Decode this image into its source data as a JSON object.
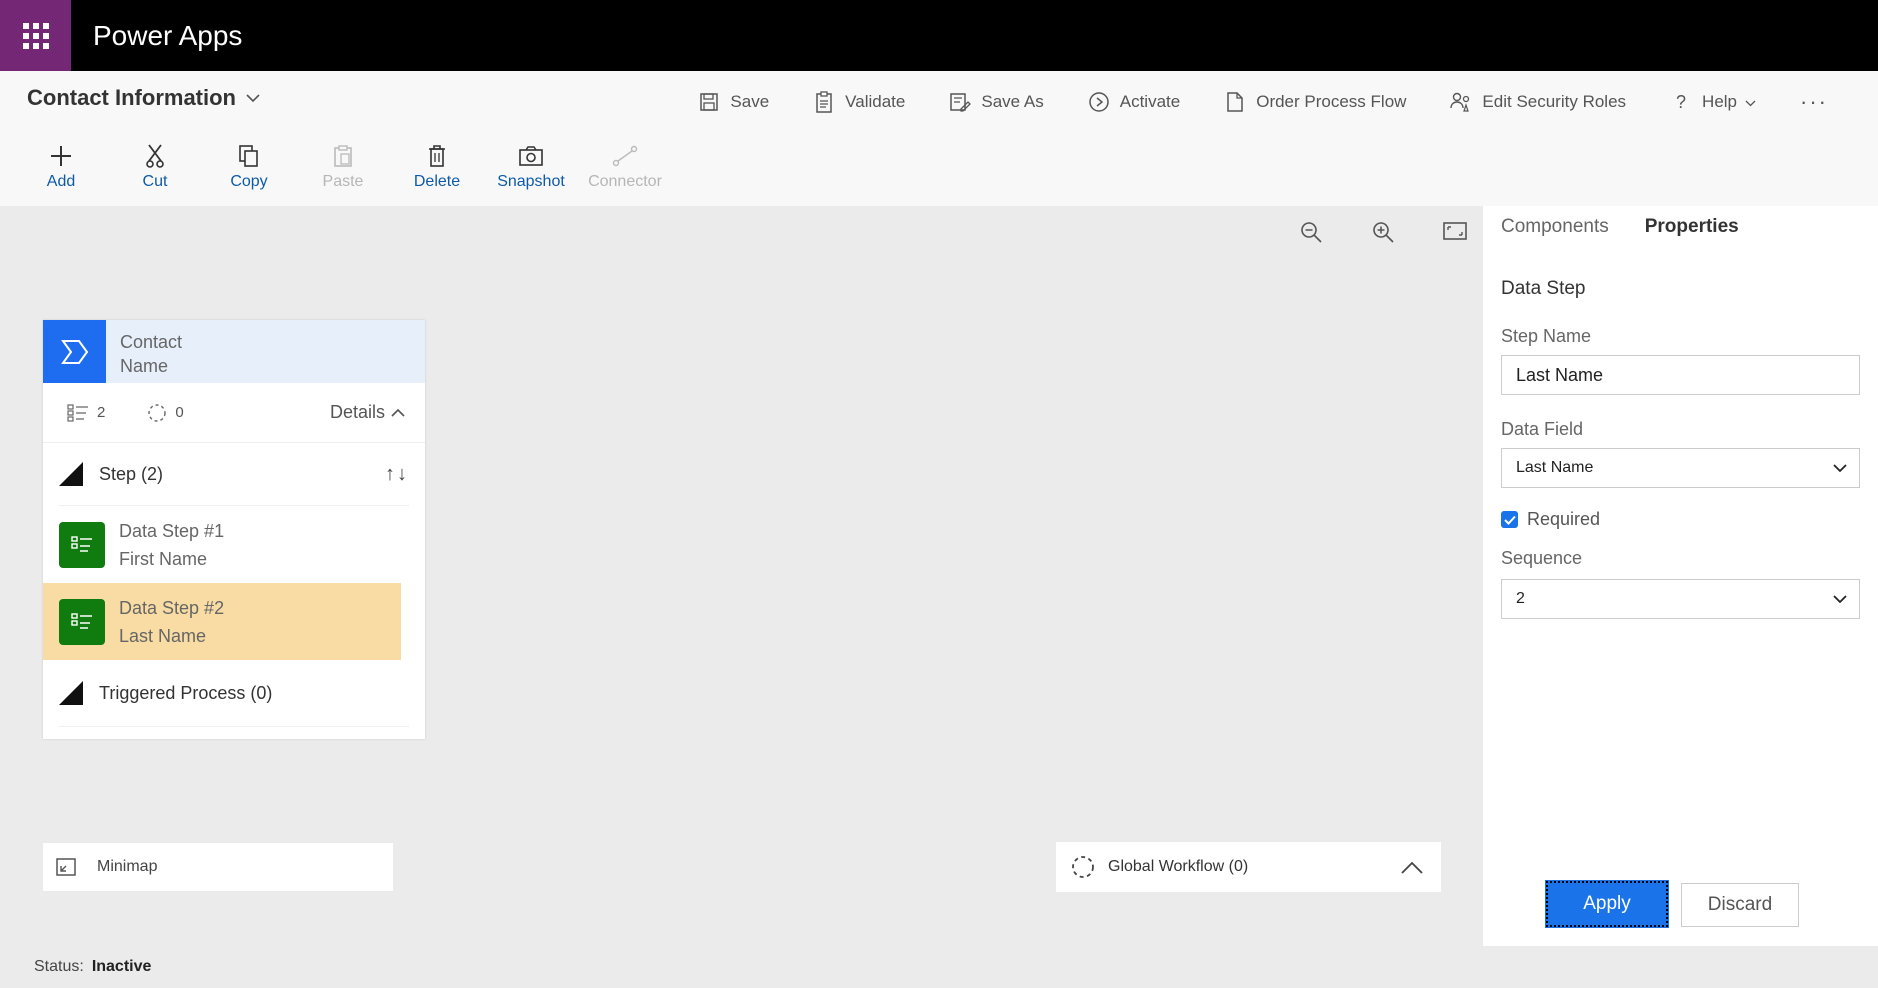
{
  "app": {
    "name": "Power Apps",
    "accent": "#742774"
  },
  "process": {
    "title": "Contact Information"
  },
  "actions": [
    {
      "label": "Save",
      "icon": "save-icon"
    },
    {
      "label": "Validate",
      "icon": "clipboard-icon"
    },
    {
      "label": "Save As",
      "icon": "save-as-icon"
    },
    {
      "label": "Activate",
      "icon": "activate-icon"
    },
    {
      "label": "Order Process Flow",
      "icon": "document-icon"
    },
    {
      "label": "Edit Security Roles",
      "icon": "security-roles-icon"
    },
    {
      "label": "Help",
      "icon": "help-icon"
    }
  ],
  "tools": [
    {
      "label": "Add",
      "icon": "plus-icon"
    },
    {
      "label": "Cut",
      "icon": "scissors-icon"
    },
    {
      "label": "Copy",
      "icon": "copy-icon"
    },
    {
      "label": "Paste",
      "icon": "paste-icon"
    },
    {
      "label": "Delete",
      "icon": "trash-icon"
    },
    {
      "label": "Snapshot",
      "icon": "camera-icon"
    },
    {
      "label": "Connector",
      "icon": "connector-icon"
    }
  ],
  "stage": {
    "name_line1": "Contact",
    "name_line2": "Name",
    "step_count": "2",
    "workflow_count": "0",
    "details_label": "Details",
    "steps_header": "Step (2)",
    "steps": [
      {
        "title": "Data Step #1",
        "field": "First Name"
      },
      {
        "title": "Data Step #2",
        "field": "Last Name"
      }
    ],
    "triggered_header": "Triggered Process (0)"
  },
  "minimap": {
    "label": "Minimap"
  },
  "global_workflow": {
    "label": "Global Workflow (0)"
  },
  "panel": {
    "tabs": [
      "Components",
      "Properties"
    ],
    "heading": "Data Step",
    "step_name_label": "Step Name",
    "step_name_value": "Last Name",
    "data_field_label": "Data Field",
    "data_field_value": "Last Name",
    "required_label": "Required",
    "sequence_label": "Sequence",
    "sequence_value": "2",
    "apply_label": "Apply",
    "discard_label": "Discard"
  },
  "status": {
    "label": "Status:",
    "value": "Inactive"
  },
  "colors": {
    "stage_blue": "#1e6df0",
    "step_green": "#107c10",
    "selected_step": "#f8dca4",
    "primary_button": "#1a73e8"
  }
}
